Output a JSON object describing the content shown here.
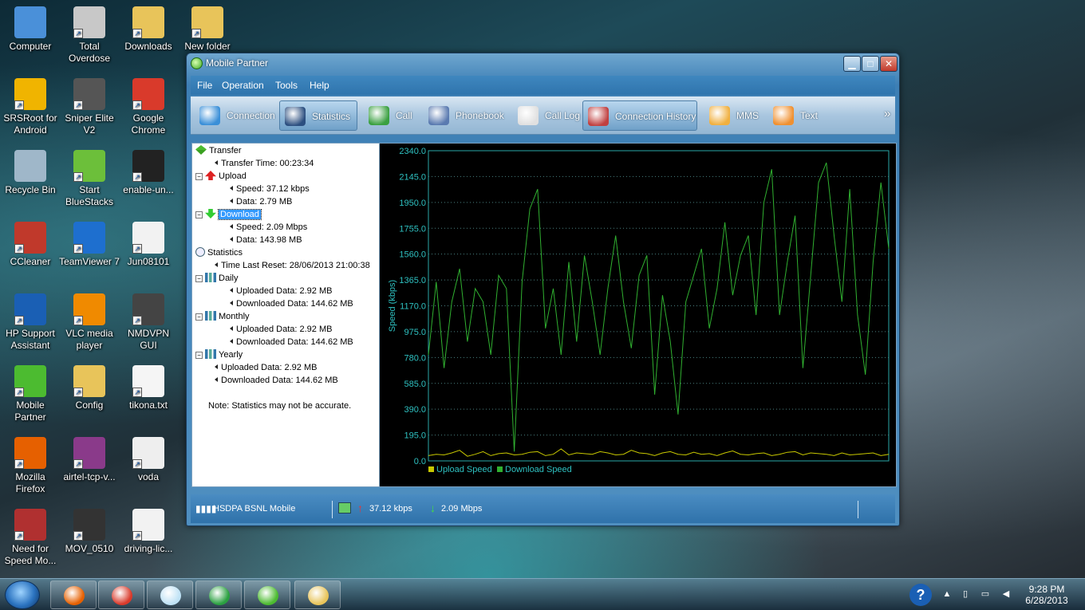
{
  "desktop": {
    "icons": [
      {
        "label": "Computer",
        "icon": "computer-icon",
        "color": "#4a90d9"
      },
      {
        "label": "Total Overdose",
        "icon": "game-icon",
        "color": "#c8c8c8"
      },
      {
        "label": "Downloads",
        "icon": "folder-icon",
        "color": "#e8c45a"
      },
      {
        "label": "New folder",
        "icon": "folder-icon",
        "color": "#e8c45a"
      },
      {
        "label": "SRSRoot for Android",
        "icon": "lock-icon",
        "color": "#f0b400"
      },
      {
        "label": "Sniper Elite V2",
        "icon": "game-icon",
        "color": "#555555"
      },
      {
        "label": "Google Chrome",
        "icon": "chrome-icon",
        "color": "#d93a2b"
      },
      {
        "label": "Recycle Bin",
        "icon": "recycle-bin-icon",
        "color": "#9fb7c9"
      },
      {
        "label": "Start BlueStacks",
        "icon": "bluestacks-icon",
        "color": "#6cbf3a"
      },
      {
        "label": "enable-un...",
        "icon": "file-icon",
        "color": "#222222"
      },
      {
        "label": "CCleaner",
        "icon": "ccleaner-icon",
        "color": "#c0392b"
      },
      {
        "label": "TeamViewer 7",
        "icon": "teamviewer-icon",
        "color": "#1e6fcf"
      },
      {
        "label": "Jun08101",
        "icon": "document-icon",
        "color": "#f2f2f2"
      },
      {
        "label": "HP Support Assistant",
        "icon": "help-icon",
        "color": "#1a5fb4"
      },
      {
        "label": "VLC media player",
        "icon": "vlc-icon",
        "color": "#f08a00"
      },
      {
        "label": "NMDVPN GUI",
        "icon": "vpn-icon",
        "color": "#444444"
      },
      {
        "label": "Mobile Partner",
        "icon": "mobile-partner-icon",
        "color": "#4cbb30"
      },
      {
        "label": "Config",
        "icon": "folder-icon",
        "color": "#e8c45a"
      },
      {
        "label": "tikona.txt",
        "icon": "text-file-icon",
        "color": "#f5f5f5"
      },
      {
        "label": "Mozilla Firefox",
        "icon": "firefox-icon",
        "color": "#e66000"
      },
      {
        "label": "airtel-tcp-v...",
        "icon": "archive-icon",
        "color": "#8a3a8a"
      },
      {
        "label": "voda",
        "icon": "image-file-icon",
        "color": "#eeeeee"
      },
      {
        "label": "Need for Speed Mo...",
        "icon": "game-icon",
        "color": "#b03030"
      },
      {
        "label": "MOV_0510",
        "icon": "video-file-icon",
        "color": "#333333"
      },
      {
        "label": "driving-lic...",
        "icon": "document-icon",
        "color": "#f2f2f2"
      }
    ]
  },
  "window": {
    "title": "Mobile Partner",
    "menu": [
      "File",
      "Operation",
      "Tools",
      "Help"
    ],
    "toolbar": [
      {
        "label": "Connection",
        "icon": "connection-icon",
        "color": "#3a8fd8"
      },
      {
        "label": "Statistics",
        "icon": "statistics-icon",
        "color": "#2c4f80"
      },
      {
        "label": "Call",
        "icon": "phone-icon",
        "color": "#3aa040"
      },
      {
        "label": "Phonebook",
        "icon": "phonebook-icon",
        "color": "#5a7ab0"
      },
      {
        "label": "Call Log",
        "icon": "call-log-icon",
        "color": "#e0e0e0"
      },
      {
        "label": "Connection History",
        "icon": "connection-history-icon",
        "color": "#c04040"
      },
      {
        "label": "MMS",
        "icon": "mms-icon",
        "color": "#f0b040"
      },
      {
        "label": "Text",
        "icon": "sms-icon",
        "color": "#f09030"
      }
    ],
    "more_glyph": "»",
    "tree": {
      "transfer": "Transfer",
      "transfer_time": "Transfer Time: 00:23:34",
      "upload": "Upload",
      "upload_speed": "Speed: 37.12 kbps",
      "upload_data": "Data: 2.79 MB",
      "download": "Download",
      "download_speed": "Speed: 2.09 Mbps",
      "download_data": "Data: 143.98 MB",
      "statistics": "Statistics",
      "time_last_reset": "Time Last Reset: 28/06/2013 21:00:38",
      "daily": "Daily",
      "daily_up": "Uploaded Data: 2.92 MB",
      "daily_down": "Downloaded Data: 144.62 MB",
      "monthly": "Monthly",
      "monthly_up": "Uploaded Data: 2.92 MB",
      "monthly_down": "Downloaded Data: 144.62 MB",
      "yearly": "Yearly",
      "yearly_up": "Uploaded Data: 2.92 MB",
      "yearly_down": "Downloaded Data: 144.62 MB",
      "note": "Note: Statistics may not be accurate."
    },
    "status": {
      "network": "HSDPA BSNL Mobile",
      "upload_speed": "37.12 kbps",
      "download_speed": "2.09 Mbps"
    }
  },
  "chart_data": {
    "type": "line",
    "title": "",
    "xlabel": "",
    "ylabel": "Speed (kbps)",
    "ylim": [
      0,
      2340
    ],
    "yticks": [
      "0.0",
      "195.0",
      "390.0",
      "585.0",
      "780.0",
      "975.0",
      "1170.0",
      "1365.0",
      "1560.0",
      "1755.0",
      "1950.0",
      "2145.0",
      "2340.0"
    ],
    "grid": true,
    "legend": "bottom-left",
    "series": [
      {
        "name": "Upload Speed",
        "color": "#c8c800",
        "values": [
          40,
          50,
          45,
          60,
          80,
          35,
          50,
          70,
          40,
          55,
          60,
          45,
          50,
          65,
          70,
          40,
          50,
          90,
          45,
          60,
          55,
          50,
          70,
          60,
          45,
          50,
          80,
          60,
          55,
          40,
          60,
          70,
          50,
          45,
          65,
          50,
          55,
          40,
          60,
          75,
          50,
          45,
          55,
          60,
          40,
          50,
          65,
          70,
          45,
          60,
          55,
          50,
          40,
          60,
          45,
          50,
          55,
          60,
          40,
          50
        ]
      },
      {
        "name": "Download Speed",
        "color": "#30b030",
        "values": [
          800,
          1350,
          700,
          1200,
          1450,
          900,
          1300,
          1200,
          800,
          1400,
          1300,
          70,
          1350,
          1900,
          2050,
          1000,
          1300,
          800,
          1500,
          900,
          1550,
          1200,
          800,
          1300,
          1700,
          1200,
          850,
          1400,
          1550,
          500,
          1250,
          900,
          350,
          1200,
          1400,
          1600,
          1000,
          1300,
          1800,
          1250,
          1550,
          1700,
          1100,
          1950,
          2200,
          1100,
          1500,
          1850,
          700,
          1400,
          2100,
          2250,
          1700,
          1200,
          2050,
          1100,
          650,
          1500,
          2100,
          1600
        ]
      }
    ]
  },
  "taskbar": {
    "time": "9:28 PM",
    "date": "6/28/2013",
    "items": [
      {
        "name": "firefox",
        "icon": "firefox-icon",
        "color": "#e66000"
      },
      {
        "name": "chrome",
        "icon": "chrome-icon",
        "color": "#d93a2b"
      },
      {
        "name": "notepad",
        "icon": "notepad-icon",
        "color": "#bfe2f5"
      },
      {
        "name": "downloader",
        "icon": "download-manager-icon",
        "color": "#2aa040"
      },
      {
        "name": "mobile-partner",
        "icon": "mobile-partner-icon",
        "color": "#4cbb30"
      },
      {
        "name": "explorer",
        "icon": "folder-icon",
        "color": "#e8c45a"
      }
    ]
  }
}
